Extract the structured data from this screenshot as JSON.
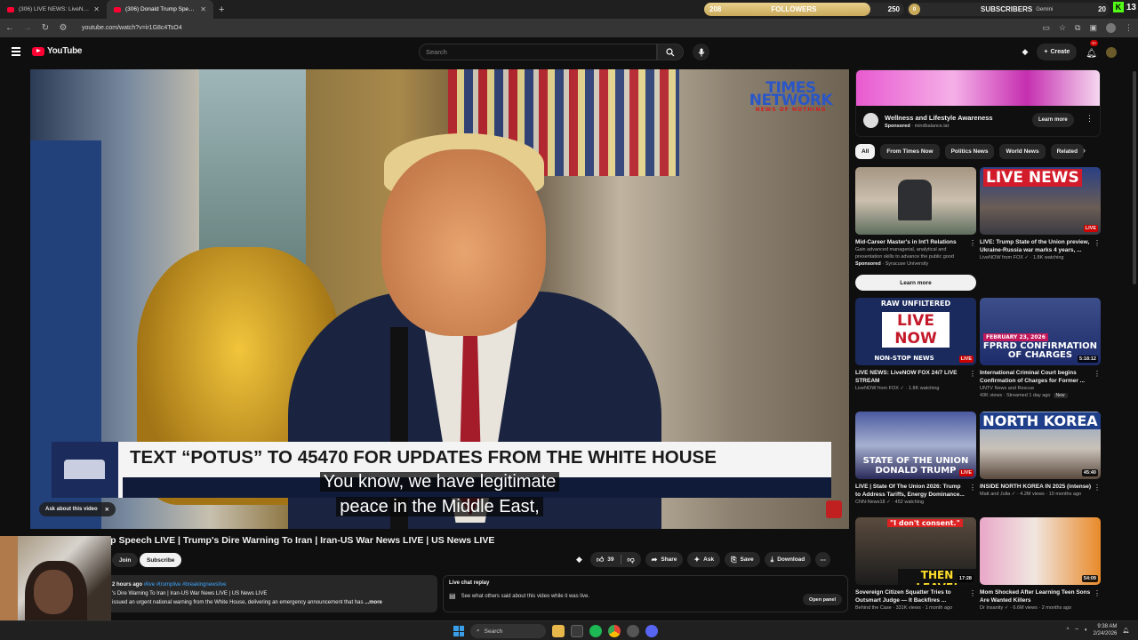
{
  "browser": {
    "tabs": [
      {
        "label": "(306) LIVE NEWS: LiveNOW FO...",
        "active": false
      },
      {
        "label": "(306) Donald Trump Speech LI...",
        "active": true
      }
    ],
    "url": "youtube.com/watch?v=ir1G8c4TsO4"
  },
  "stream_overlay": {
    "followers_current": "208",
    "followers_label": "FOLLOWERS",
    "followers_goal": "250",
    "followers_progress": 0.832,
    "subscribers_current": "0",
    "subscribers_label": "SUBSCRIBERS",
    "gemini_label": "Gemini",
    "subscribers_goal": "20",
    "corner_count": "13"
  },
  "youtube": {
    "logo_text": "YouTube",
    "search_placeholder": "Search",
    "create_label": "Create",
    "notification_count": "9+"
  },
  "video": {
    "watermark_line1": "TIMES",
    "watermark_line2": "NETWORK",
    "watermark_tagline": "NEWS OF NOTHING",
    "banner_text": "TEXT “POTUS” TO 45470 FOR UPDATES FROM THE WHITE HOUSE",
    "caption_line1": "You know, we have legitimate",
    "caption_line2": "peace in the Middle East,",
    "ask_label": "Ask about this video",
    "title": "Donald Trump Speech LIVE | Trump's Dire Warning To Iran | Iran-US War News LIVE | US News LIVE"
  },
  "channel": {
    "join_label": "Join",
    "subscribe_label": "Subscribe"
  },
  "actions": {
    "like_count": "39",
    "share_label": "Share",
    "ask_label": "Ask",
    "save_label": "Save",
    "download_label": "Download"
  },
  "description": {
    "meta": "2 hours ago",
    "tags": "#live #trumplive #breakingnewslive",
    "line1": "'s Dire Warning To Iran | Iran-US War News LIVE | US News LIVE",
    "line2": "issued an urgent national warning from the White House, delivering an emergency announcement that has",
    "more": "...more"
  },
  "live_chat": {
    "title": "Live chat replay",
    "text": "See what others said about this video while it was live.",
    "open_label": "Open panel"
  },
  "ad": {
    "title": "Wellness and Lifestyle Awareness",
    "sponsored": "Sponsored",
    "domain": "mindbalance.lat",
    "learn_label": "Learn more"
  },
  "chips": [
    "All",
    "From Times Now",
    "Politics News",
    "World News",
    "Related"
  ],
  "recommendations": [
    {
      "title": "Mid-Career Master's in Int'l Relations",
      "meta1": "Gain advanced managerial, analytical and presentation skills to advance the public good",
      "meta2": "Syracuse University",
      "sponsored": "Sponsored",
      "button": "Learn more"
    },
    {
      "title": "LIVE: Trump State of the Union preview, Ukraine-Russia war marks 4 years, ...",
      "meta1": "LiveNOW from FOX",
      "meta2": "1.8K watching",
      "badge": "LIVE",
      "thumb_text": "LIVE NEWS"
    },
    {
      "title": "LIVE NEWS: LiveNOW FOX 24/7 LIVE STREAM",
      "meta1": "LiveNOW from FOX",
      "meta2": "1.8K watching",
      "badge": "LIVE",
      "thumb_top": "RAW  UNFILTERED",
      "thumb_mid": "LIVE NOW",
      "thumb_bot": "NON-STOP NEWS"
    },
    {
      "title": "International Criminal Court begins Confirmation of Charges for Former ...",
      "meta1": "UNTV News and Rescue",
      "meta2": "43K views · Streamed 1 day ago",
      "new": "New",
      "duration": "5:18:12",
      "thumb_date": "FEBRUARY 23, 2026",
      "thumb_text": "FPRRD CONFIRMATION OF CHARGES"
    },
    {
      "title": "LIVE | State Of The Union 2026: Trump to Address Tariffs, Energy Dominance...",
      "meta1": "CNN-News18",
      "meta2": "452 watching",
      "badge": "LIVE",
      "thumb_text": "STATE OF THE UNION DONALD TRUMP"
    },
    {
      "title": "INSIDE NORTH KOREA IN 2025 (intense)",
      "meta1": "Matt and Julia",
      "meta2": "4.2M views · 10 months ago",
      "duration": "45:40",
      "thumb_text": "NORTH KOREA"
    },
    {
      "title": "Sovereign Citizen Squatter Tries to Outsmart Judge — It Backfires ...",
      "meta1": "Behind the Case",
      "meta2": "331K views · 1 month ago",
      "duration": "17:28",
      "thumb_top": "\"I don't consent.\"",
      "thumb_bot": "THEN LEAVE!"
    },
    {
      "title": "Mom Shocked After Learning Teen Sons Are Wanted Killers",
      "meta1": "Dr Insanity",
      "meta2": "6.6M views · 2 months ago",
      "duration": "54:09"
    }
  ],
  "taskbar": {
    "search_label": "Search",
    "time": "9:38 AM",
    "date": "2/24/2026"
  }
}
